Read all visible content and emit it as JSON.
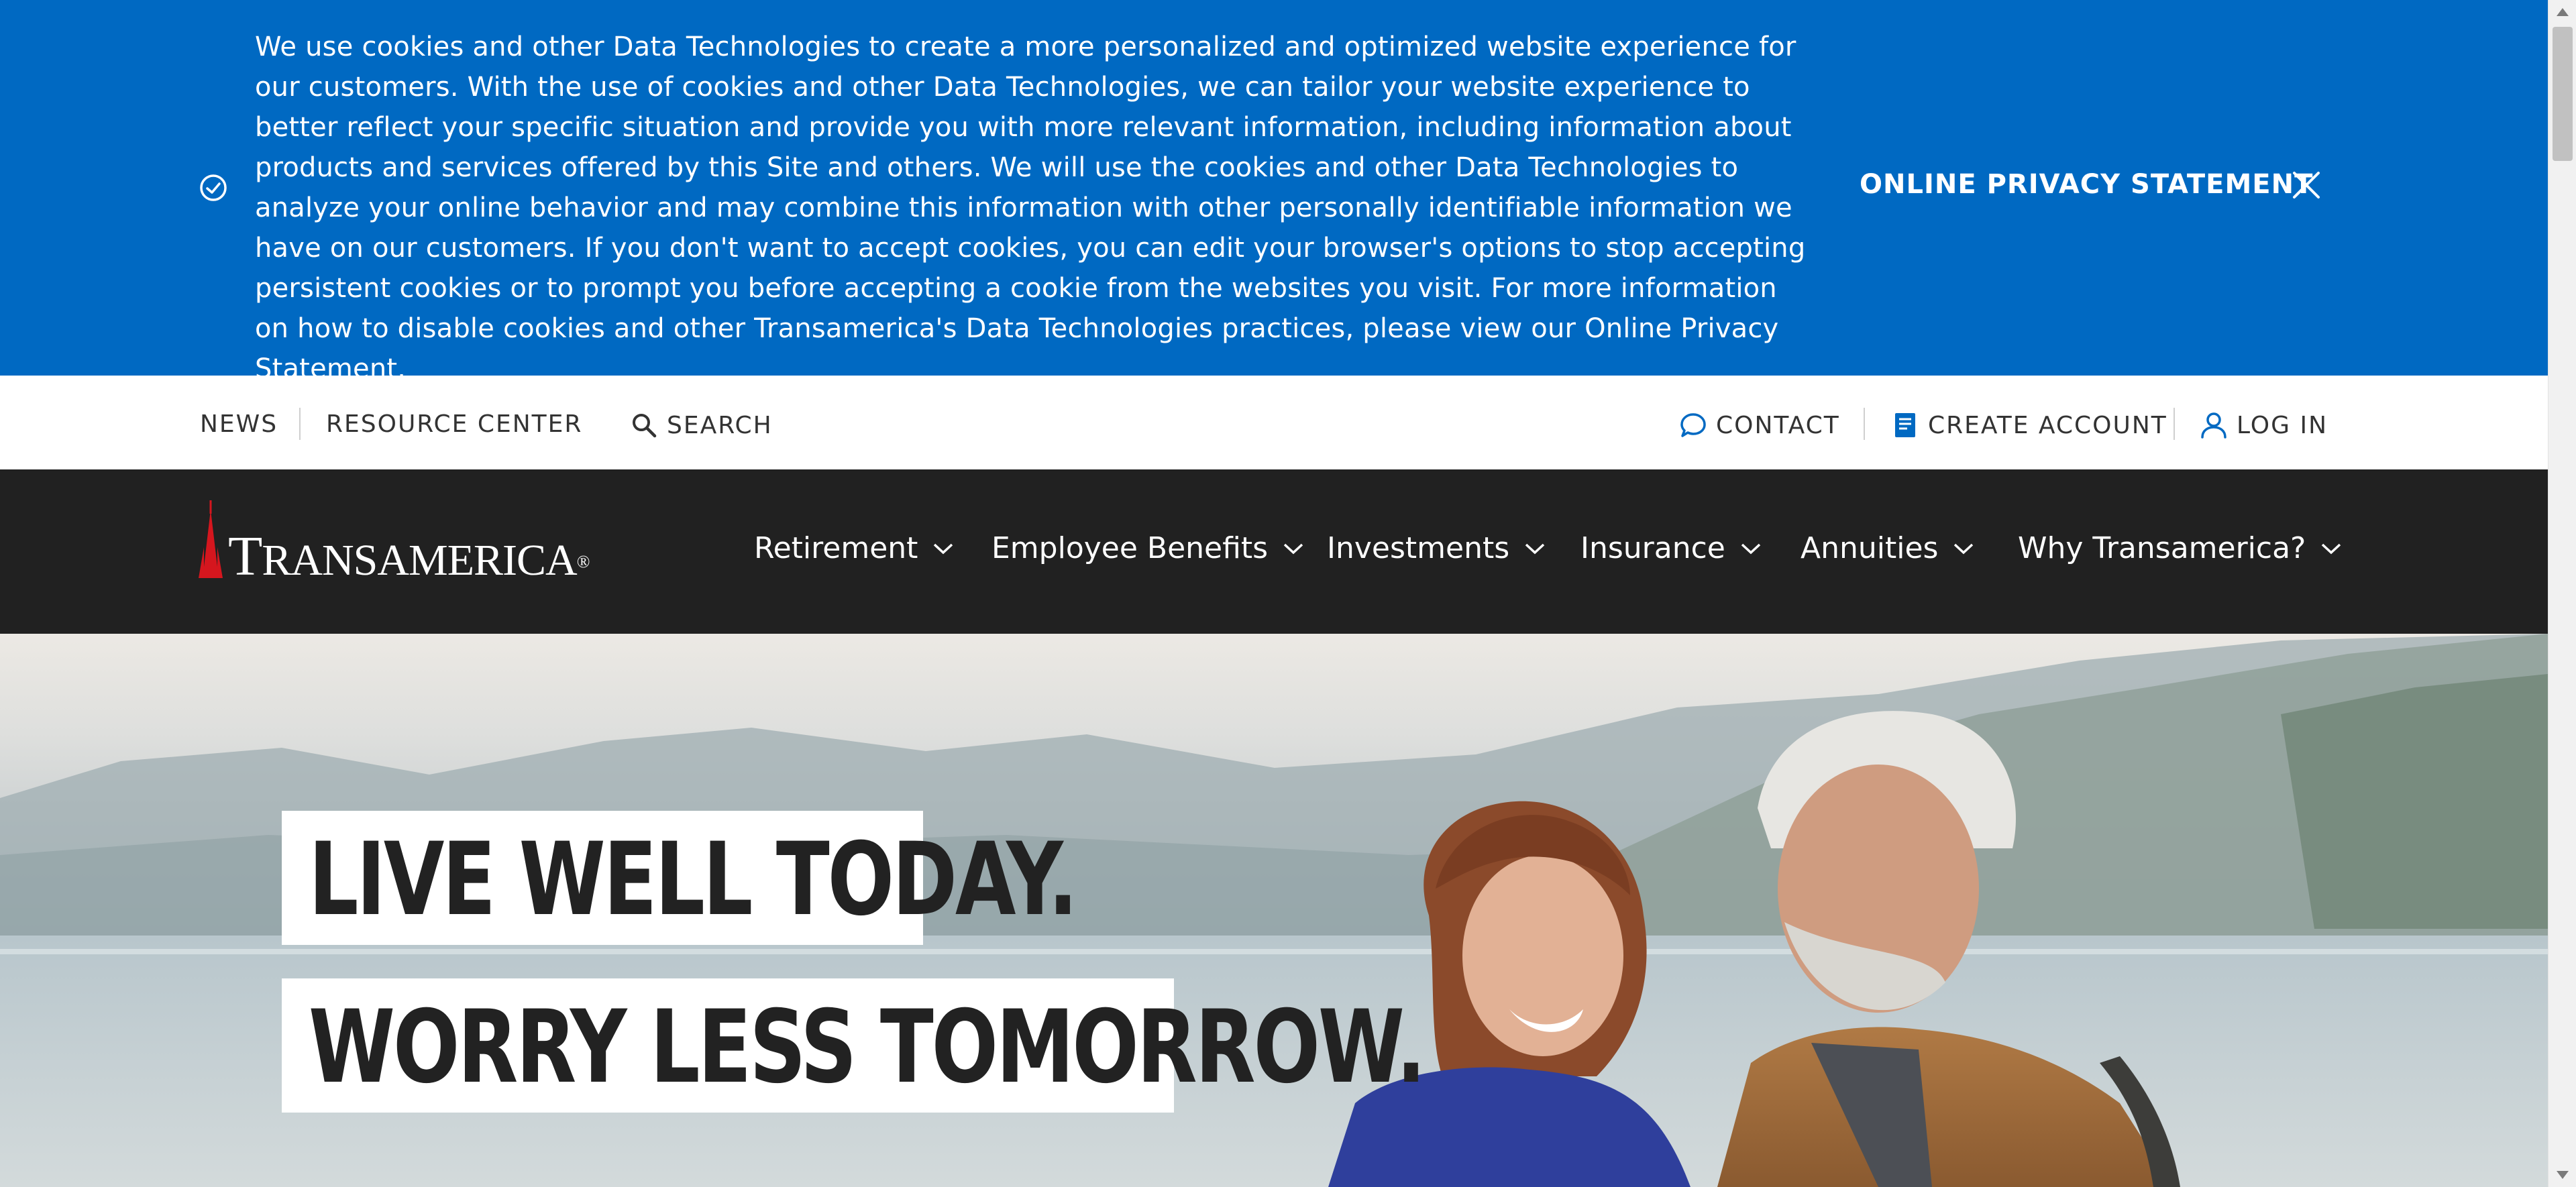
{
  "cookie_banner": {
    "text": "We use cookies and other Data Technologies to create a more personalized and optimized website experience for our customers. With the use of cookies and other Data Technologies, we can tailor your website experience to better reflect your specific situation and provide you with more relevant information, including information about products and services offered by this Site and others. We will use the cookies and other Data Technologies to analyze your online behavior and may combine this information with other personally identifiable information we have on our customers. If you don't want to accept cookies, you can edit your browser's options to stop accepting persistent cookies or to prompt you before accepting a cookie from the websites you visit. For more information on how to disable cookies and other Transamerica's Data Technologies practices, please view our Online Privacy Statement.",
    "privacy_link": "ONLINE PRIVACY STATEMENT",
    "check_icon": "check-circle-icon",
    "close_icon": "close-icon",
    "background_color": "#0069c2"
  },
  "utility_bar": {
    "news": "NEWS",
    "resource_center": "RESOURCE CENTER",
    "search": "SEARCH",
    "contact": "CONTACT",
    "create_account": "CREATE ACCOUNT",
    "log_in": "LOG IN",
    "icons": [
      "search-icon",
      "chat-bubble-icon",
      "account-form-icon",
      "user-icon"
    ],
    "accent_color": "#0069c2"
  },
  "main_nav": {
    "logo_text_first": "T",
    "logo_text_rest": "RANSAMERICA",
    "logo_mark": "®",
    "items": [
      {
        "label": "Retirement"
      },
      {
        "label": "Employee Benefits"
      },
      {
        "label": "Investments"
      },
      {
        "label": "Insurance"
      },
      {
        "label": "Annuities"
      },
      {
        "label": "Why Transamerica?"
      }
    ],
    "background_color": "#212121",
    "logo_accent_color": "#d5161e"
  },
  "hero": {
    "headline_1": "LIVE WELL TODAY.",
    "headline_2": "WORRY LESS TOMORROW."
  }
}
